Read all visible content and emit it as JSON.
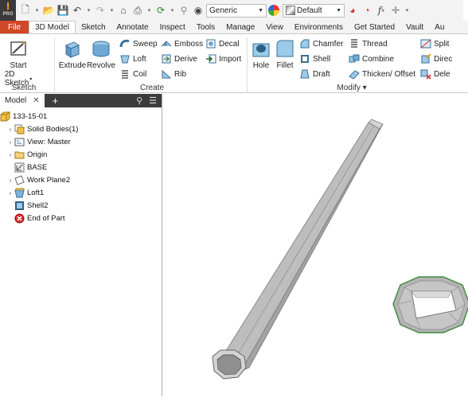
{
  "qat": {
    "logo_text": "I",
    "logo_sub": "PRO",
    "material": "Generic",
    "appearance": "Default"
  },
  "tabs": [
    "File",
    "3D Model",
    "Sketch",
    "Annotate",
    "Inspect",
    "Tools",
    "Manage",
    "View",
    "Environments",
    "Get Started",
    "Vault",
    "Au"
  ],
  "active_tab": "3D Model",
  "ribbon": {
    "start_sketch": "Start",
    "start_sketch_2": "2D Sketch",
    "extrude": "Extrude",
    "revolve": "Revolve",
    "sweep": "Sweep",
    "emboss": "Emboss",
    "decal": "Decal",
    "loft": "Loft",
    "derive": "Derive",
    "import": "Import",
    "coil": "Coil",
    "rib": "Rib",
    "hole": "Hole",
    "fillet": "Fillet",
    "chamfer": "Chamfer",
    "thread": "Thread",
    "split": "Split",
    "shell": "Shell",
    "combine": "Combine",
    "direct": "Direc",
    "draft": "Draft",
    "thicken": "Thicken/ Offset",
    "delete": "Dele",
    "panels": {
      "sketch": "Sketch",
      "create": "Create",
      "modify": "Modify ▾"
    }
  },
  "browser": {
    "tab": "Model",
    "items": [
      {
        "label": "133-15-01",
        "icon": "part-icon",
        "twisty": ""
      },
      {
        "label": "Solid Bodies(1)",
        "icon": "solid-bodies-icon",
        "twisty": "›"
      },
      {
        "label": "View: Master",
        "icon": "view-icon",
        "twisty": "›"
      },
      {
        "label": "Origin",
        "icon": "folder-icon",
        "twisty": "›"
      },
      {
        "label": "BASE",
        "icon": "sketch-icon",
        "twisty": ""
      },
      {
        "label": "Work Plane2",
        "icon": "work-plane-icon",
        "twisty": "›"
      },
      {
        "label": "Loft1",
        "icon": "loft-icon",
        "twisty": "›"
      },
      {
        "label": "Shell2",
        "icon": "shell-icon",
        "twisty": ""
      },
      {
        "label": "End of Part",
        "icon": "end-of-part-icon",
        "twisty": ""
      }
    ]
  },
  "colors": {
    "file_tab": "#d24726",
    "browser_header": "#3c3c3c",
    "model_body": "#b5b5b5"
  }
}
